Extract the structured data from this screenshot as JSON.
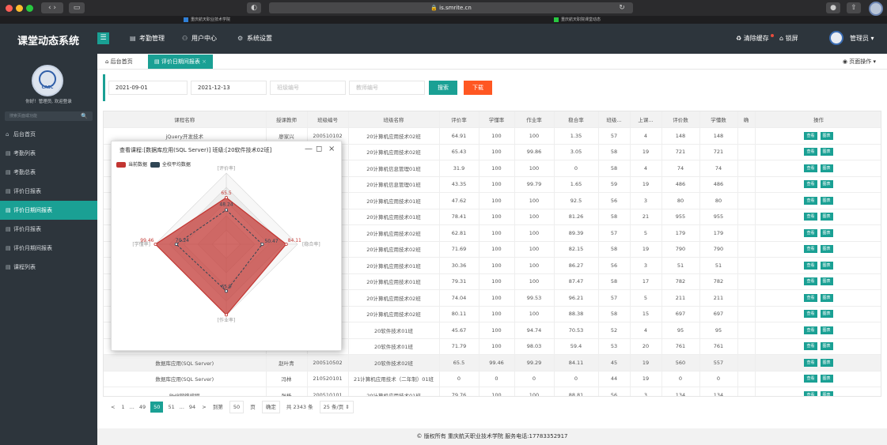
{
  "browser": {
    "url": "is.smrite.cn",
    "tab_left": "重庆航天职业技术学院",
    "tab_right": "重庆航天职院课堂动态"
  },
  "app": {
    "title": "课堂动态系统",
    "nav": [
      "考勤管理",
      "用户中心",
      "系统设置"
    ],
    "clear_cache": "清除缓存",
    "lock": "锁屏",
    "admin": "管理员"
  },
  "sidebar": {
    "logo_text": "CASC",
    "greeting": "你好！管理员, 欢迎登录",
    "search_placeholder": "搜索页面或功能",
    "items": [
      "后台首页",
      "考勤列表",
      "考勤总表",
      "评价日报表",
      "评价日期间报表",
      "评价月报表",
      "评价月期间报表",
      "课程列表"
    ],
    "active_index": 4
  },
  "page_tabs": {
    "home": "后台首页",
    "current": "评价日期间报表",
    "page_ops": "页面操作"
  },
  "filter": {
    "start_date": "2021-09-01",
    "end_date": "2021-12-13",
    "class_placeholder": "班级编号",
    "teacher_placeholder": "教师编号",
    "search_label": "搜索",
    "download_label": "下载"
  },
  "table": {
    "headers": [
      "课程名称",
      "授课教师",
      "班级编号",
      "班级名称",
      "评价率",
      "学懂率",
      "作业率",
      "稳合率",
      "班级...",
      "上课...",
      "评价数",
      "学懂数",
      "确",
      "操作"
    ],
    "op_view": "查看",
    "op_chart": "图表",
    "rows": [
      [
        "jQuery开发技术",
        "廖家兴",
        "200510102",
        "20计算机应用技术02班",
        "64.91",
        "100",
        "100",
        "1.35",
        "57",
        "4",
        "148",
        "148"
      ],
      [
        "",
        "",
        "10102",
        "20计算机应用技术02班",
        "65.43",
        "100",
        "99.86",
        "3.05",
        "58",
        "19",
        "721",
        "721"
      ],
      [
        "",
        "",
        "10701",
        "20计算机信息管理01班",
        "31.9",
        "100",
        "100",
        "0",
        "58",
        "4",
        "74",
        "74"
      ],
      [
        "",
        "",
        "10701",
        "20计算机信息管理01班",
        "43.35",
        "100",
        "99.79",
        "1.65",
        "59",
        "19",
        "486",
        "486"
      ],
      [
        "",
        "",
        "10101",
        "20计算机应用技术01班",
        "47.62",
        "100",
        "100",
        "92.5",
        "56",
        "3",
        "80",
        "80"
      ],
      [
        "",
        "",
        "10101",
        "20计算机应用技术01班",
        "78.41",
        "100",
        "100",
        "81.26",
        "58",
        "21",
        "955",
        "955"
      ],
      [
        "",
        "",
        "10102",
        "20计算机应用技术02班",
        "62.81",
        "100",
        "100",
        "89.39",
        "57",
        "5",
        "179",
        "179"
      ],
      [
        "",
        "",
        "10102",
        "20计算机应用技术02班",
        "71.69",
        "100",
        "100",
        "82.15",
        "58",
        "19",
        "790",
        "790"
      ],
      [
        "",
        "",
        "10101",
        "20计算机应用技术01班",
        "30.36",
        "100",
        "100",
        "86.27",
        "56",
        "3",
        "51",
        "51"
      ],
      [
        "",
        "",
        "10101",
        "20计算机应用技术01班",
        "79.31",
        "100",
        "100",
        "87.47",
        "58",
        "17",
        "782",
        "782"
      ],
      [
        "",
        "",
        "10102",
        "20计算机应用技术02班",
        "74.04",
        "100",
        "99.53",
        "96.21",
        "57",
        "5",
        "211",
        "211"
      ],
      [
        "",
        "",
        "10102",
        "20计算机应用技术02班",
        "80.11",
        "100",
        "100",
        "88.38",
        "58",
        "15",
        "697",
        "697"
      ],
      [
        "",
        "",
        "10501",
        "20软件技术01班",
        "45.67",
        "100",
        "94.74",
        "70.53",
        "52",
        "4",
        "95",
        "95"
      ],
      [
        "",
        "",
        "10501",
        "20软件技术01班",
        "71.79",
        "100",
        "98.03",
        "59.4",
        "53",
        "20",
        "761",
        "761"
      ],
      [
        "数据库应用(SQL Server)",
        "赵叶青",
        "200510502",
        "20软件技术02班",
        "65.5",
        "99.46",
        "99.29",
        "84.11",
        "45",
        "19",
        "560",
        "557"
      ],
      [
        "数据库应用(SQL Server)",
        "冯林",
        "210520101",
        "21计算机应用技术（二年制）01班",
        "0",
        "0",
        "0",
        "0",
        "44",
        "19",
        "0",
        "0"
      ],
      [
        "PHP网络编程",
        "张杨",
        "200510101",
        "20计算机应用技术01班",
        "79.76",
        "100",
        "100",
        "88.81",
        "56",
        "3",
        "134",
        "134"
      ]
    ],
    "highlight_row": 14
  },
  "pagination": {
    "prev": "<",
    "pages": [
      "1",
      "...",
      "49",
      "50",
      "51",
      "...",
      "94"
    ],
    "current": "50",
    "next": ">",
    "goto_label": "到第",
    "goto_value": "50",
    "page_unit": "页",
    "confirm": "确定",
    "total": "共 2343 条",
    "per_page": "25 条/页"
  },
  "footer": "© 版权所有 重庆航天职业技术学院 服务电话:17783352917",
  "popup": {
    "title": "查看课程:[数据库应用(SQL Server)] 班级:[20软件技术02班]",
    "minimize": "—",
    "maximize": "◻",
    "close": "×"
  },
  "chart_data": {
    "type": "radar",
    "indicators": [
      "评价率",
      "稳合率",
      "作业率",
      "学懂率"
    ],
    "max": 100,
    "series": [
      {
        "name": "当前数据",
        "values": [
          65.5,
          84.11,
          99.29,
          99.46
        ],
        "color": "#c23531"
      },
      {
        "name": "全校平均数据",
        "values": [
          48.24,
          50.47,
          65.9,
          70.24
        ],
        "color": "#2f4554"
      }
    ],
    "data_labels": [
      "65.5",
      "48.24",
      "50.47",
      "84.11",
      "99.46",
      "70.24",
      "65.9"
    ]
  },
  "colors": {
    "accent": "#1aa094",
    "dark": "#2d353c",
    "download": "#ff5722"
  }
}
